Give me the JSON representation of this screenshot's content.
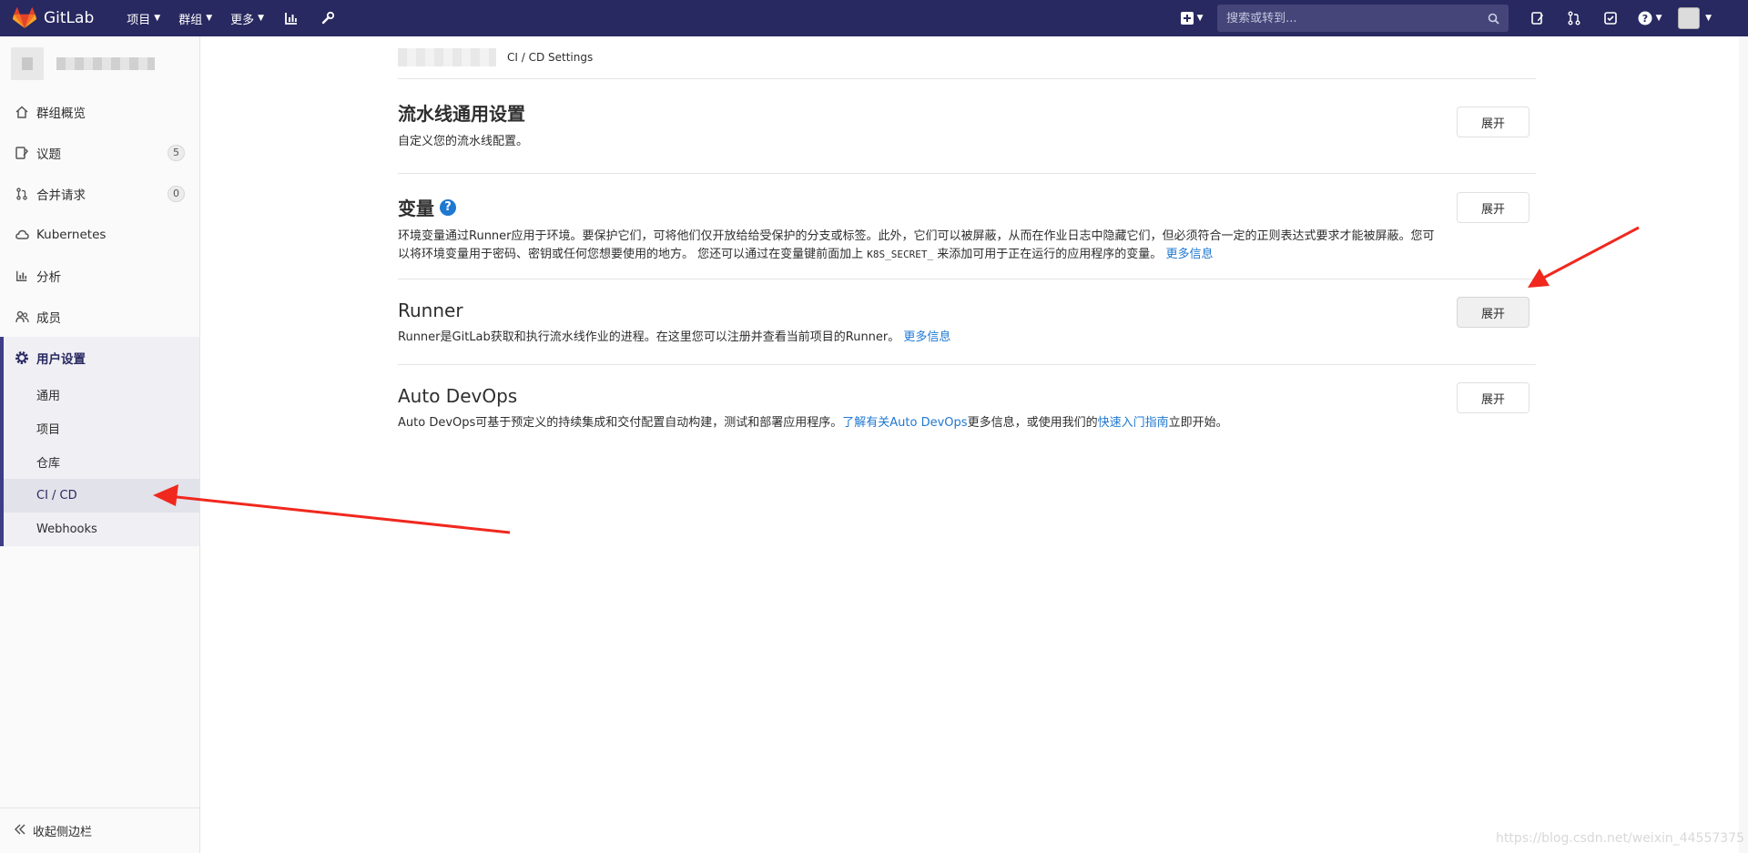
{
  "navbar": {
    "brand": "GitLab",
    "menus": [
      {
        "label": "项目"
      },
      {
        "label": "群组"
      },
      {
        "label": "更多"
      }
    ],
    "search_placeholder": "搜索或转到...",
    "icons": [
      "activity-chart-icon",
      "wrench-icon",
      "plus-square-icon",
      "todo-issues-icon",
      "merge-request-icon",
      "todo-check-icon",
      "help-icon"
    ],
    "colors": {
      "bg": "#292961",
      "search_bg": "#45457a"
    }
  },
  "sidebar": {
    "items": [
      {
        "label": "群组概览",
        "icon": "home-icon"
      },
      {
        "label": "议题",
        "icon": "issues-icon",
        "badge": "5"
      },
      {
        "label": "合并请求",
        "icon": "merge-request-icon",
        "badge": "0"
      },
      {
        "label": "Kubernetes",
        "icon": "cloud-icon"
      },
      {
        "label": "分析",
        "icon": "chart-icon"
      },
      {
        "label": "成员",
        "icon": "users-icon"
      }
    ],
    "settings": {
      "label": "用户设置",
      "sub": [
        "通用",
        "项目",
        "仓库",
        "CI / CD",
        "Webhooks"
      ],
      "current": "CI / CD"
    },
    "collapse_label": "收起侧边栏"
  },
  "breadcrumb": {
    "current": "CI / CD Settings"
  },
  "sections": {
    "pipeline": {
      "title": "流水线通用设置",
      "desc": "自定义您的流水线配置。",
      "button": "展开"
    },
    "variables": {
      "title": "变量",
      "desc_1": "环境变量通过Runner应用于环境。要保护它们，可将他们仅开放给给受保护的分支或标签。此外，它们可以被屏蔽，从而在作业日志中隐藏它们，但必须符合一定的正则表达式要求才能被屏蔽。您可以将环境变量用于密码、密钥或任何您想要使用的地方。 您还可以通过在变量键前面加上",
      "code": "K8S_SECRET_",
      "desc_2": "来添加可用于正在运行的应用程序的变量。",
      "link": "更多信息",
      "button": "展开"
    },
    "runner": {
      "title": "Runner",
      "desc": "Runner是GitLab获取和执行流水线作业的进程。在这里您可以注册并查看当前项目的Runner。",
      "link": "更多信息",
      "button": "展开"
    },
    "autodevops": {
      "title": "Auto DevOps",
      "desc_1": "Auto DevOps可基于预定义的持续集成和交付配置自动构建，测试和部署应用程序。",
      "link_1": "了解有关Auto DevOps",
      "desc_2": "更多信息，或使用我们的",
      "link_2": "快速入门指南",
      "desc_3": "立即开始。",
      "button": "展开"
    }
  },
  "watermark": "https://blog.csdn.net/weixin_44557375",
  "annotation_color": "#f0281e"
}
